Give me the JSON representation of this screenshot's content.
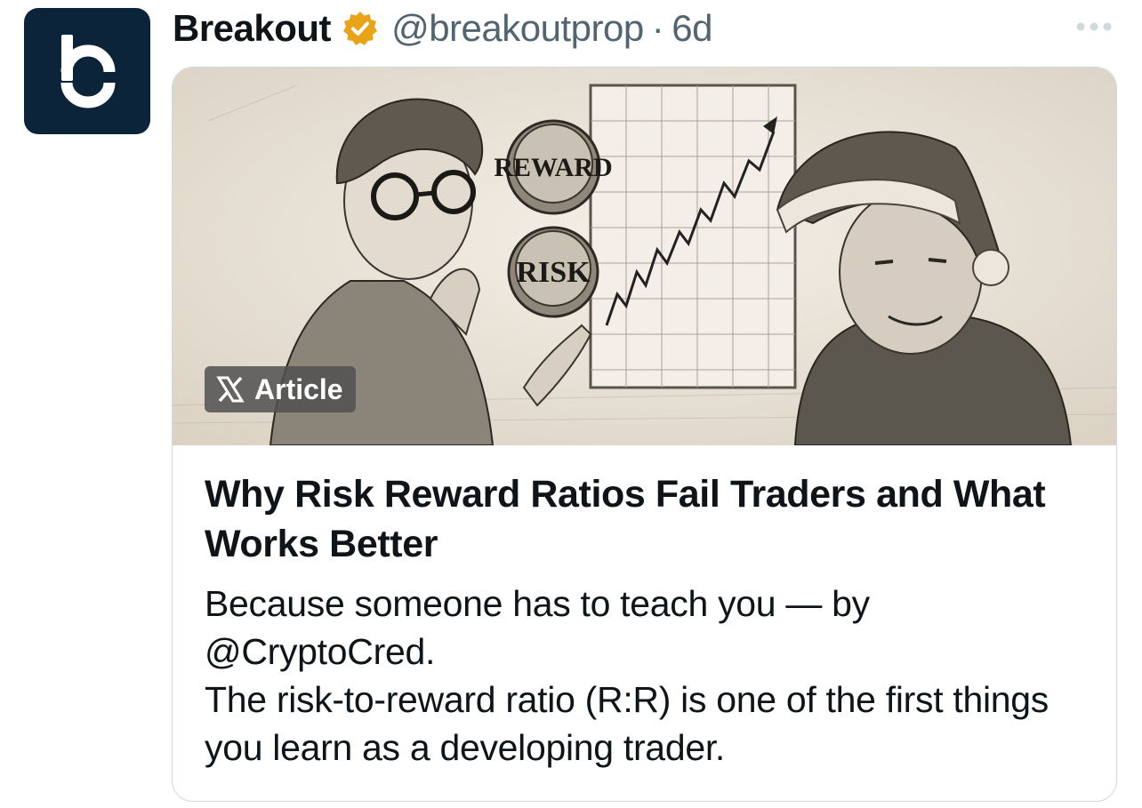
{
  "author": {
    "display_name": "Breakout",
    "handle": "@breakoutprop",
    "separator": "·",
    "time": "6d",
    "avatar_icon": "breakout-b-logo",
    "verified_icon": "verified-gold-badge",
    "verified_color": "#f4b400"
  },
  "more_icon": "ellipsis-horizontal",
  "card": {
    "image_description_icon": "sketch-illustration",
    "image_labels": {
      "reward": "REWARD",
      "risk": "RISK"
    },
    "badge": {
      "icon": "x-logo",
      "label": "Article"
    },
    "title": "Why Risk Reward Ratios Fail Traders and What Works Better",
    "body_lines": [
      "Because someone has to teach you — by @CryptoCred.",
      "The risk-to-reward ratio (R:R) is one of the first things you learn as a developing trader."
    ]
  },
  "colors": {
    "text_primary": "#0f1419",
    "text_secondary": "#536471",
    "border": "#cfd9de",
    "avatar_bg": "#0c2439"
  }
}
